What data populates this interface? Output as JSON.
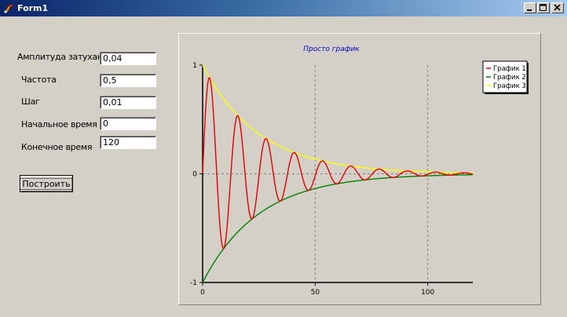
{
  "window": {
    "title": "Form1"
  },
  "form": {
    "fields": [
      {
        "label": "Амплитуда затухания",
        "value": "0,04"
      },
      {
        "label": "Частота",
        "value": "0,5"
      },
      {
        "label": "Шаг",
        "value": "0,01"
      },
      {
        "label": "Начальное время",
        "value": "0"
      },
      {
        "label": "Конечное время",
        "value": "120"
      }
    ],
    "build_button_label": "Построить"
  },
  "chart_data": {
    "type": "line",
    "title": "Просто график",
    "xlabel": "",
    "ylabel": "",
    "xlim": [
      0,
      120
    ],
    "ylim": [
      -1,
      1
    ],
    "x_ticks": [
      0,
      50,
      100
    ],
    "y_ticks": [
      -1,
      0,
      1
    ],
    "grid": true,
    "legend_position": "top-right",
    "series": [
      {
        "name": "График 1",
        "color": "#e00000",
        "formula": "exp(-0.04*t)*sin(0.5*t)",
        "t_start": 0,
        "t_end": 120,
        "step": 0.01
      },
      {
        "name": "График 2",
        "color": "#008000",
        "formula": "-exp(-0.04*t)",
        "t_start": 0,
        "t_end": 120,
        "step": 0.01
      },
      {
        "name": "График 3",
        "color": "#ffff00",
        "formula": "exp(-0.04*t)",
        "t_start": 0,
        "t_end": 120,
        "step": 0.01
      }
    ]
  }
}
